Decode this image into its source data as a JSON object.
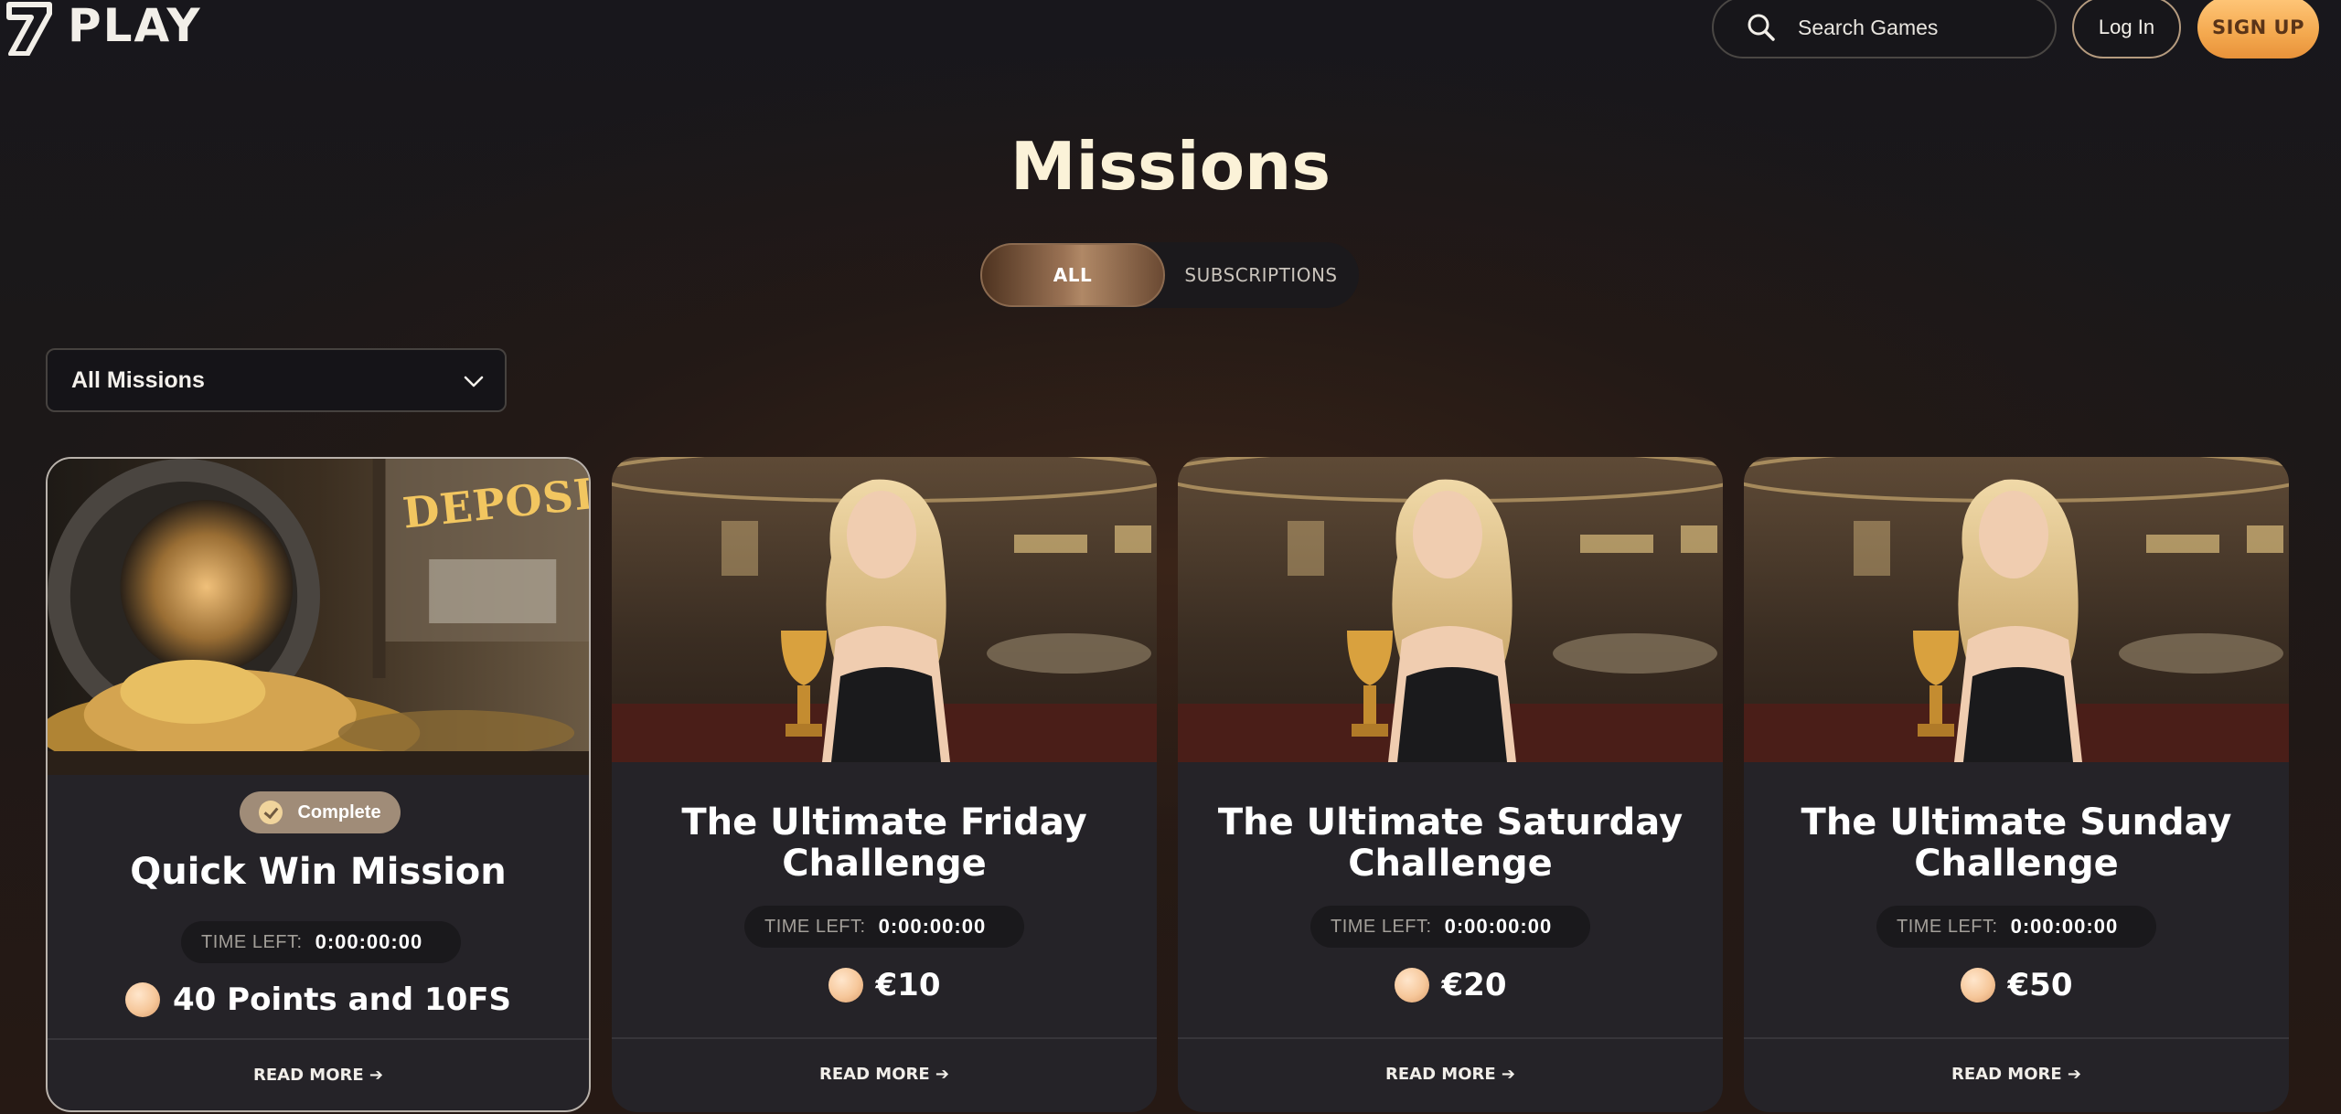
{
  "header": {
    "logo_text": "PLAY",
    "search_placeholder": "Search Games",
    "login_label": "Log In",
    "signup_label": "SIGN UP"
  },
  "page": {
    "title": "Missions"
  },
  "tabs": [
    {
      "label": "ALL",
      "active": true
    },
    {
      "label": "SUBSCRIPTIONS",
      "active": false
    }
  ],
  "filter": {
    "selected": "All Missions"
  },
  "missions": [
    {
      "title": "Quick Win Mission",
      "status": "Complete",
      "time_left_label": "TIME LEFT:",
      "time_left": "0:00:00:00",
      "reward": "40 Points and 10FS",
      "read_more": "READ MORE ➔",
      "image": "deposit-vault-coins"
    },
    {
      "title": "The Ultimate Friday Challenge",
      "time_left_label": "TIME LEFT:",
      "time_left": "0:00:00:00",
      "reward": "€10",
      "read_more": "READ MORE ➔",
      "image": "woman-with-trophy"
    },
    {
      "title": "The Ultimate Saturday Challenge",
      "time_left_label": "TIME LEFT:",
      "time_left": "0:00:00:00",
      "reward": "€20",
      "read_more": "READ MORE ➔",
      "image": "woman-with-trophy"
    },
    {
      "title": "The Ultimate Sunday Challenge",
      "time_left_label": "TIME LEFT:",
      "time_left": "0:00:00:00",
      "reward": "€50",
      "read_more": "READ MORE ➔",
      "image": "woman-with-trophy"
    }
  ],
  "colors": {
    "accent_gold": "#f4a94f",
    "title_cream": "#fbf2d8",
    "card_bg": "#252328",
    "badge_bg": "#a08c78"
  }
}
